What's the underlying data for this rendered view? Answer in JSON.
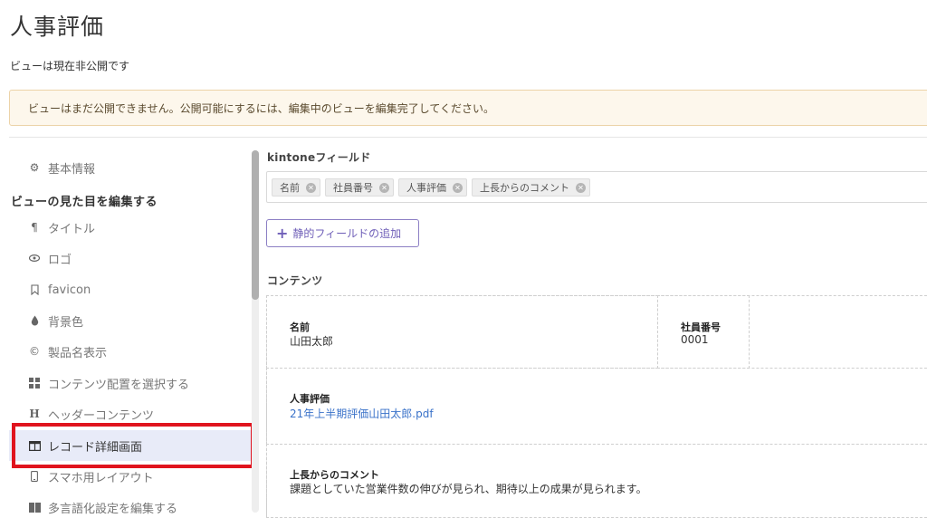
{
  "header": {
    "title": "人事評価",
    "status": "ビューは現在非公開です"
  },
  "notice": "ビューはまだ公開できません。公開可能にするには、編集中のビューを編集完了してください。",
  "sidebar": {
    "basic_info": "基本情報",
    "heading": "ビューの見た目を編集する",
    "items": [
      {
        "label": "タイトル",
        "icon": "pilcrow-icon"
      },
      {
        "label": "ロゴ",
        "icon": "eye-icon"
      },
      {
        "label": "favicon",
        "icon": "bookmark-icon"
      },
      {
        "label": "背景色",
        "icon": "droplet-icon"
      },
      {
        "label": "製品名表示",
        "icon": "copyright-icon"
      },
      {
        "label": "コンテンツ配置を選択する",
        "icon": "grid-icon"
      },
      {
        "label": "ヘッダーコンテンツ",
        "icon": "heading-icon"
      },
      {
        "label": "レコード詳細画面",
        "icon": "columns-icon"
      },
      {
        "label": "スマホ用レイアウト",
        "icon": "mobile-icon"
      },
      {
        "label": "多言語化設定を編集する",
        "icon": "language-icon"
      }
    ],
    "active_index": 7,
    "highlight_color": "#e0141e"
  },
  "fields_section": {
    "label": "kintoneフィールド",
    "chips": [
      "名前",
      "社員番号",
      "人事評価",
      "上長からのコメント"
    ],
    "add_button": "静的フィールドの追加"
  },
  "content_section": {
    "label": "コンテンツ",
    "cells": {
      "name": {
        "label": "名前",
        "value": "山田太郎"
      },
      "employee_no": {
        "label": "社員番号",
        "value": "0001"
      },
      "evaluation": {
        "label": "人事評価",
        "value": "21年上半期評価山田太郎.pdf"
      },
      "comment": {
        "label": "上長からのコメント",
        "value": "課題としていた営業件数の伸びが見られ、期待以上の成果が見られます。"
      }
    }
  },
  "colors": {
    "accent": "#6f5fb8",
    "link": "#3a72c9",
    "notice_bg": "#fdf7ec",
    "active_bg": "#e8ebf8"
  }
}
